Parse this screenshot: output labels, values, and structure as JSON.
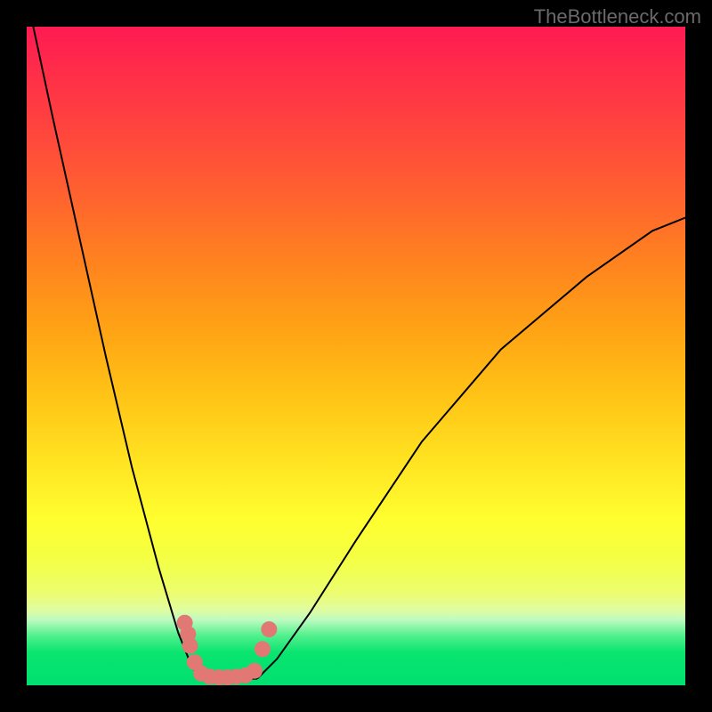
{
  "watermark": "TheBottleneck.com",
  "chart_data": {
    "type": "line",
    "note": "No numeric axes are visible. The curve is a V-shaped bottleneck function plotted over a color gradient. A cluster of pinkish dots sits at the trough.",
    "xlim": [
      0,
      1
    ],
    "ylim": [
      0,
      1
    ],
    "title": "",
    "xlabel": "",
    "ylabel": "",
    "series": [
      {
        "name": "left-curve",
        "x": [
          0.01,
          0.04,
          0.08,
          0.12,
          0.16,
          0.2,
          0.23,
          0.25,
          0.26,
          0.262
        ],
        "y": [
          1.0,
          0.86,
          0.68,
          0.5,
          0.33,
          0.18,
          0.08,
          0.03,
          0.015,
          0.01
        ]
      },
      {
        "name": "right-curve",
        "x": [
          0.35,
          0.38,
          0.43,
          0.5,
          0.6,
          0.72,
          0.85,
          0.95,
          1.0
        ],
        "y": [
          0.01,
          0.04,
          0.11,
          0.22,
          0.37,
          0.51,
          0.62,
          0.69,
          0.71
        ]
      }
    ],
    "scatter": {
      "name": "trough-dots",
      "color": "#e17873",
      "points": [
        {
          "x": 0.24,
          "y": 0.095
        },
        {
          "x": 0.245,
          "y": 0.078
        },
        {
          "x": 0.248,
          "y": 0.06
        },
        {
          "x": 0.255,
          "y": 0.035
        },
        {
          "x": 0.265,
          "y": 0.018
        },
        {
          "x": 0.278,
          "y": 0.013
        },
        {
          "x": 0.292,
          "y": 0.012
        },
        {
          "x": 0.305,
          "y": 0.012
        },
        {
          "x": 0.318,
          "y": 0.013
        },
        {
          "x": 0.332,
          "y": 0.015
        },
        {
          "x": 0.346,
          "y": 0.022
        },
        {
          "x": 0.358,
          "y": 0.055
        },
        {
          "x": 0.368,
          "y": 0.085
        }
      ]
    },
    "gradient_stops": [
      {
        "pos": 0.0,
        "color": "#ff1a52"
      },
      {
        "pos": 0.5,
        "color": "#ffcc15"
      },
      {
        "pos": 0.8,
        "color": "#ffff30"
      },
      {
        "pos": 0.92,
        "color": "#50f08c"
      },
      {
        "pos": 1.0,
        "color": "#00e070"
      }
    ]
  }
}
